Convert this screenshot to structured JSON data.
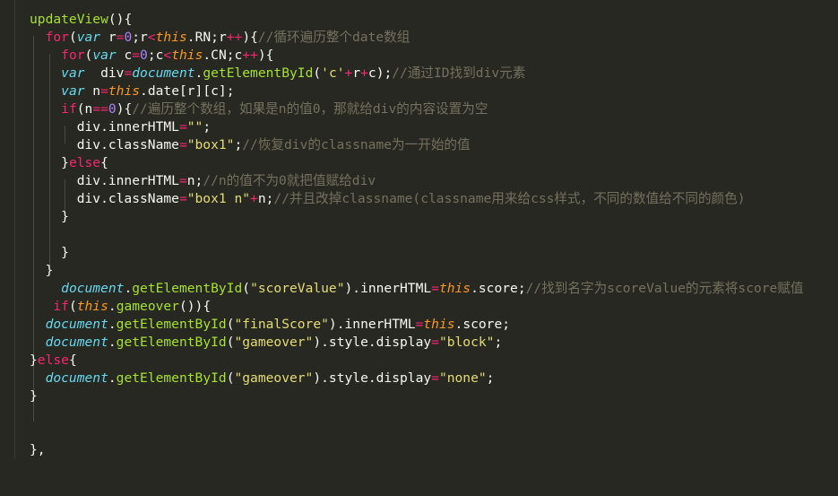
{
  "editor": {
    "theme": "monokai",
    "colors": {
      "background": "#272822",
      "plain": "#f8f8f2",
      "keyword": "#f92672",
      "storage": "#66d9ef",
      "this": "#fd971f",
      "function": "#a6e22e",
      "number": "#ae81ff",
      "string": "#e6db74",
      "comment": "#75715e"
    },
    "lines": [
      [
        [
          "func",
          "updateView"
        ],
        [
          "plain",
          "(){"
        ]
      ],
      [
        [
          "plain",
          "  "
        ],
        [
          "keyword",
          "for"
        ],
        [
          "plain",
          "("
        ],
        [
          "storage",
          "var"
        ],
        [
          "plain",
          " r"
        ],
        [
          "op",
          "="
        ],
        [
          "number",
          "0"
        ],
        [
          "plain",
          ";r"
        ],
        [
          "op",
          "<"
        ],
        [
          "this",
          "this"
        ],
        [
          "plain",
          ".RN;r"
        ],
        [
          "op",
          "++"
        ],
        [
          "plain",
          "){"
        ],
        [
          "comment",
          "//循环遍历整个date数组"
        ]
      ],
      [
        [
          "plain",
          "    "
        ],
        [
          "keyword",
          "for"
        ],
        [
          "plain",
          "("
        ],
        [
          "storage",
          "var"
        ],
        [
          "plain",
          " c"
        ],
        [
          "op",
          "="
        ],
        [
          "number",
          "0"
        ],
        [
          "plain",
          ";c"
        ],
        [
          "op",
          "<"
        ],
        [
          "this",
          "this"
        ],
        [
          "plain",
          ".CN;c"
        ],
        [
          "op",
          "++"
        ],
        [
          "plain",
          "){"
        ]
      ],
      [
        [
          "plain",
          "    "
        ],
        [
          "storage",
          "var"
        ],
        [
          "plain",
          "  div"
        ],
        [
          "op",
          "="
        ],
        [
          "builtin",
          "document"
        ],
        [
          "plain",
          "."
        ],
        [
          "func",
          "getElementById"
        ],
        [
          "plain",
          "("
        ],
        [
          "string",
          "'c'"
        ],
        [
          "op",
          "+"
        ],
        [
          "plain",
          "r"
        ],
        [
          "op",
          "+"
        ],
        [
          "plain",
          "c);"
        ],
        [
          "comment",
          "//通过ID找到div元素"
        ]
      ],
      [
        [
          "plain",
          "    "
        ],
        [
          "storage",
          "var"
        ],
        [
          "plain",
          " n"
        ],
        [
          "op",
          "="
        ],
        [
          "this",
          "this"
        ],
        [
          "plain",
          ".date[r][c];"
        ]
      ],
      [
        [
          "plain",
          "    "
        ],
        [
          "keyword",
          "if"
        ],
        [
          "plain",
          "(n"
        ],
        [
          "op",
          "=="
        ],
        [
          "number",
          "0"
        ],
        [
          "plain",
          "){"
        ],
        [
          "comment",
          "//遍历整个数组，如果是n的值0，那就给div的内容设置为空"
        ]
      ],
      [
        [
          "plain",
          "      div.innerHTML"
        ],
        [
          "op",
          "="
        ],
        [
          "string",
          "\"\""
        ],
        [
          "plain",
          ";"
        ]
      ],
      [
        [
          "plain",
          "      div.className"
        ],
        [
          "op",
          "="
        ],
        [
          "string",
          "\"box1\""
        ],
        [
          "plain",
          ";"
        ],
        [
          "comment",
          "//恢复div的classname为一开始的值"
        ]
      ],
      [
        [
          "plain",
          "    }"
        ],
        [
          "keyword",
          "else"
        ],
        [
          "plain",
          "{"
        ]
      ],
      [
        [
          "plain",
          "      div.innerHTML"
        ],
        [
          "op",
          "="
        ],
        [
          "plain",
          "n;"
        ],
        [
          "comment",
          "//n的值不为0就把值赋给div"
        ]
      ],
      [
        [
          "plain",
          "      div.className"
        ],
        [
          "op",
          "="
        ],
        [
          "string",
          "\"box1 n\""
        ],
        [
          "op",
          "+"
        ],
        [
          "plain",
          "n;"
        ],
        [
          "comment",
          "//并且改掉classname(classname用来给css样式，不同的数值给不同的颜色)"
        ]
      ],
      [
        [
          "plain",
          "    }"
        ]
      ],
      [
        [
          "plain",
          ""
        ]
      ],
      [
        [
          "plain",
          "    }"
        ]
      ],
      [
        [
          "plain",
          "  }"
        ]
      ],
      [
        [
          "plain",
          "    "
        ],
        [
          "builtin",
          "document"
        ],
        [
          "plain",
          "."
        ],
        [
          "func",
          "getElementById"
        ],
        [
          "plain",
          "("
        ],
        [
          "string",
          "\"scoreValue\""
        ],
        [
          "plain",
          ").innerHTML"
        ],
        [
          "op",
          "="
        ],
        [
          "this",
          "this"
        ],
        [
          "plain",
          ".score;"
        ],
        [
          "comment",
          "//找到名字为scoreValue的元素将score赋值"
        ]
      ],
      [
        [
          "plain",
          "   "
        ],
        [
          "keyword",
          "if"
        ],
        [
          "plain",
          "("
        ],
        [
          "this",
          "this"
        ],
        [
          "plain",
          "."
        ],
        [
          "func",
          "gameover"
        ],
        [
          "plain",
          "()){"
        ]
      ],
      [
        [
          "plain",
          "  "
        ],
        [
          "builtin",
          "document"
        ],
        [
          "plain",
          "."
        ],
        [
          "func",
          "getElementById"
        ],
        [
          "plain",
          "("
        ],
        [
          "string",
          "\"finalScore\""
        ],
        [
          "plain",
          ").innerHTML"
        ],
        [
          "op",
          "="
        ],
        [
          "this",
          "this"
        ],
        [
          "plain",
          ".score;"
        ]
      ],
      [
        [
          "plain",
          "  "
        ],
        [
          "builtin",
          "document"
        ],
        [
          "plain",
          "."
        ],
        [
          "func",
          "getElementById"
        ],
        [
          "plain",
          "("
        ],
        [
          "string",
          "\"gameover\""
        ],
        [
          "plain",
          ").style.display"
        ],
        [
          "op",
          "="
        ],
        [
          "string",
          "\"block\""
        ],
        [
          "plain",
          ";"
        ]
      ],
      [
        [
          "plain",
          "}"
        ],
        [
          "keyword",
          "else"
        ],
        [
          "plain",
          "{"
        ]
      ],
      [
        [
          "plain",
          "  "
        ],
        [
          "builtin",
          "document"
        ],
        [
          "plain",
          "."
        ],
        [
          "func",
          "getElementById"
        ],
        [
          "plain",
          "("
        ],
        [
          "string",
          "\"gameover\""
        ],
        [
          "plain",
          ").style.display"
        ],
        [
          "op",
          "="
        ],
        [
          "string",
          "\"none\""
        ],
        [
          "plain",
          ";"
        ]
      ],
      [
        [
          "plain",
          "}"
        ]
      ],
      [
        [
          "plain",
          ""
        ]
      ],
      [
        [
          "plain",
          ""
        ]
      ],
      [
        [
          "plain",
          "},"
        ]
      ]
    ]
  }
}
